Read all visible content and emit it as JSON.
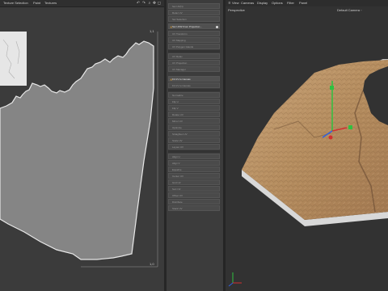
{
  "uv_editor": {
    "menu": [
      {
        "id": "texture-selection",
        "label": "Texture Selection"
      },
      {
        "id": "paint",
        "label": "Paint"
      },
      {
        "id": "textures",
        "label": "Textures"
      }
    ],
    "toolbar_icons": [
      "undo-icon",
      "redo-icon",
      "search-icon",
      "move-icon",
      "zoom-icon",
      "maximize-icon"
    ],
    "coords": {
      "top_left": "0,0",
      "top_right": "1,1",
      "bottom_right": "1,0"
    }
  },
  "commands": {
    "group1": [
      "Set UV(N)",
      "Relax UV",
      "Set Selection",
      "Set UVW From Projection...",
      "UV Transform",
      "UV Mapping",
      "UV Polygon Islands",
      "UV Relax",
      "UV Projection",
      "UV Manager"
    ],
    "group2": [
      "Fit UV to Canvas",
      "Fit UV to Canvas"
    ],
    "group3": [
      "Normalize",
      "Flip U",
      "Flip V",
      "Rotate UV",
      "Mirror UV",
      "Optimize",
      "Straighten UV",
      "Scale UV",
      "Layout UV",
      "Pack UV"
    ],
    "group4": [
      "Align U",
      "Align V",
      "Equalize",
      "Center UV",
      "Grid UV",
      "Sort UV",
      "Offset UV",
      "Distribute",
      "Stack UV",
      "Split UV",
      "Weld UV"
    ],
    "active_label": "Set UVW From Projection...",
    "fit_label": "Fit UV to Canvas"
  },
  "viewport": {
    "menu": [
      {
        "id": "view",
        "label": "View"
      },
      {
        "id": "cameras",
        "label": "Cameras"
      },
      {
        "id": "display",
        "label": "Display"
      },
      {
        "id": "options",
        "label": "Options"
      },
      {
        "id": "filter",
        "label": "Filter"
      },
      {
        "id": "panel",
        "label": "Panel"
      }
    ],
    "camera_label": "Perspective",
    "default_camera": "Default Camera",
    "default_camera_icon": "camera-icon"
  },
  "colors": {
    "accent_orange": "#e0a030",
    "axis_x": "#d03030",
    "axis_y": "#30c040",
    "axis_z": "#3060e0"
  }
}
